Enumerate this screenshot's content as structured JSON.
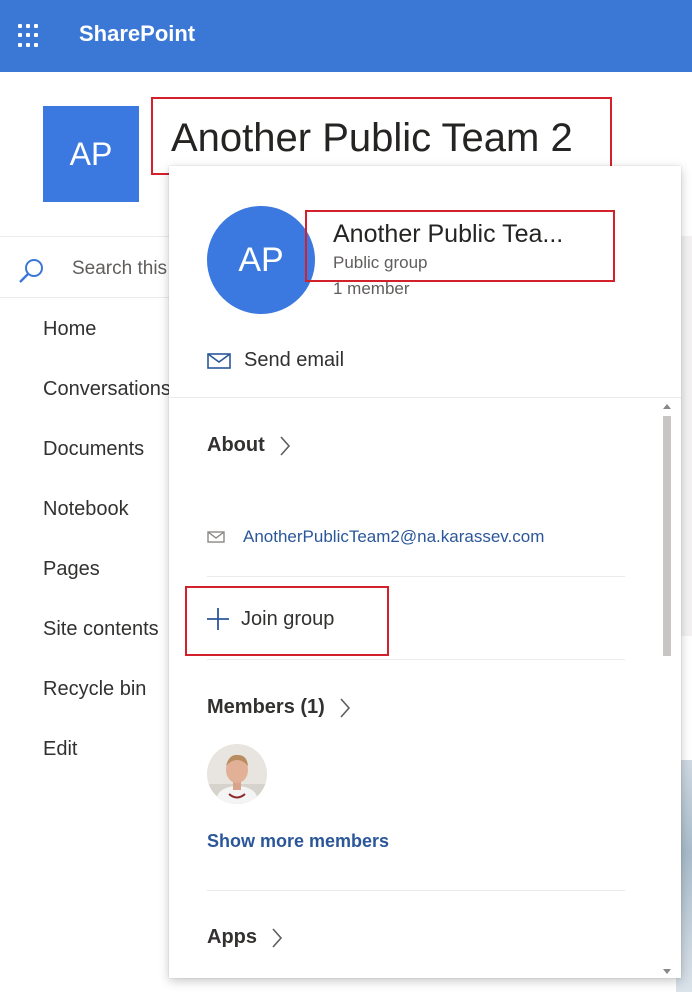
{
  "suite": {
    "title": "SharePoint"
  },
  "site": {
    "initials": "AP",
    "title": "Another Public Team 2"
  },
  "search": {
    "placeholder": "Search this site"
  },
  "nav": {
    "items": [
      {
        "label": "Home"
      },
      {
        "label": "Conversations"
      },
      {
        "label": "Documents"
      },
      {
        "label": "Notebook"
      },
      {
        "label": "Pages"
      },
      {
        "label": "Site contents"
      },
      {
        "label": "Recycle bin"
      },
      {
        "label": "Edit"
      }
    ]
  },
  "card": {
    "initials": "AP",
    "name": "Another Public Tea...",
    "type": "Public group",
    "members_count": "1 member",
    "send_email": "Send email",
    "about": {
      "label": "About"
    },
    "email": "AnotherPublicTeam2@na.karassev.com",
    "join": "Join group",
    "members": {
      "label": "Members (1)",
      "show_more": "Show more members"
    },
    "apps": {
      "label": "Apps"
    }
  },
  "colors": {
    "suite_bar": "#3b78d6",
    "avatar": "#3b78e0",
    "highlight": "#d3212c",
    "link": "#2b579a"
  },
  "icons": [
    "waffle-icon",
    "search-icon",
    "mail-icon",
    "chevron-right-icon",
    "plus-icon"
  ]
}
